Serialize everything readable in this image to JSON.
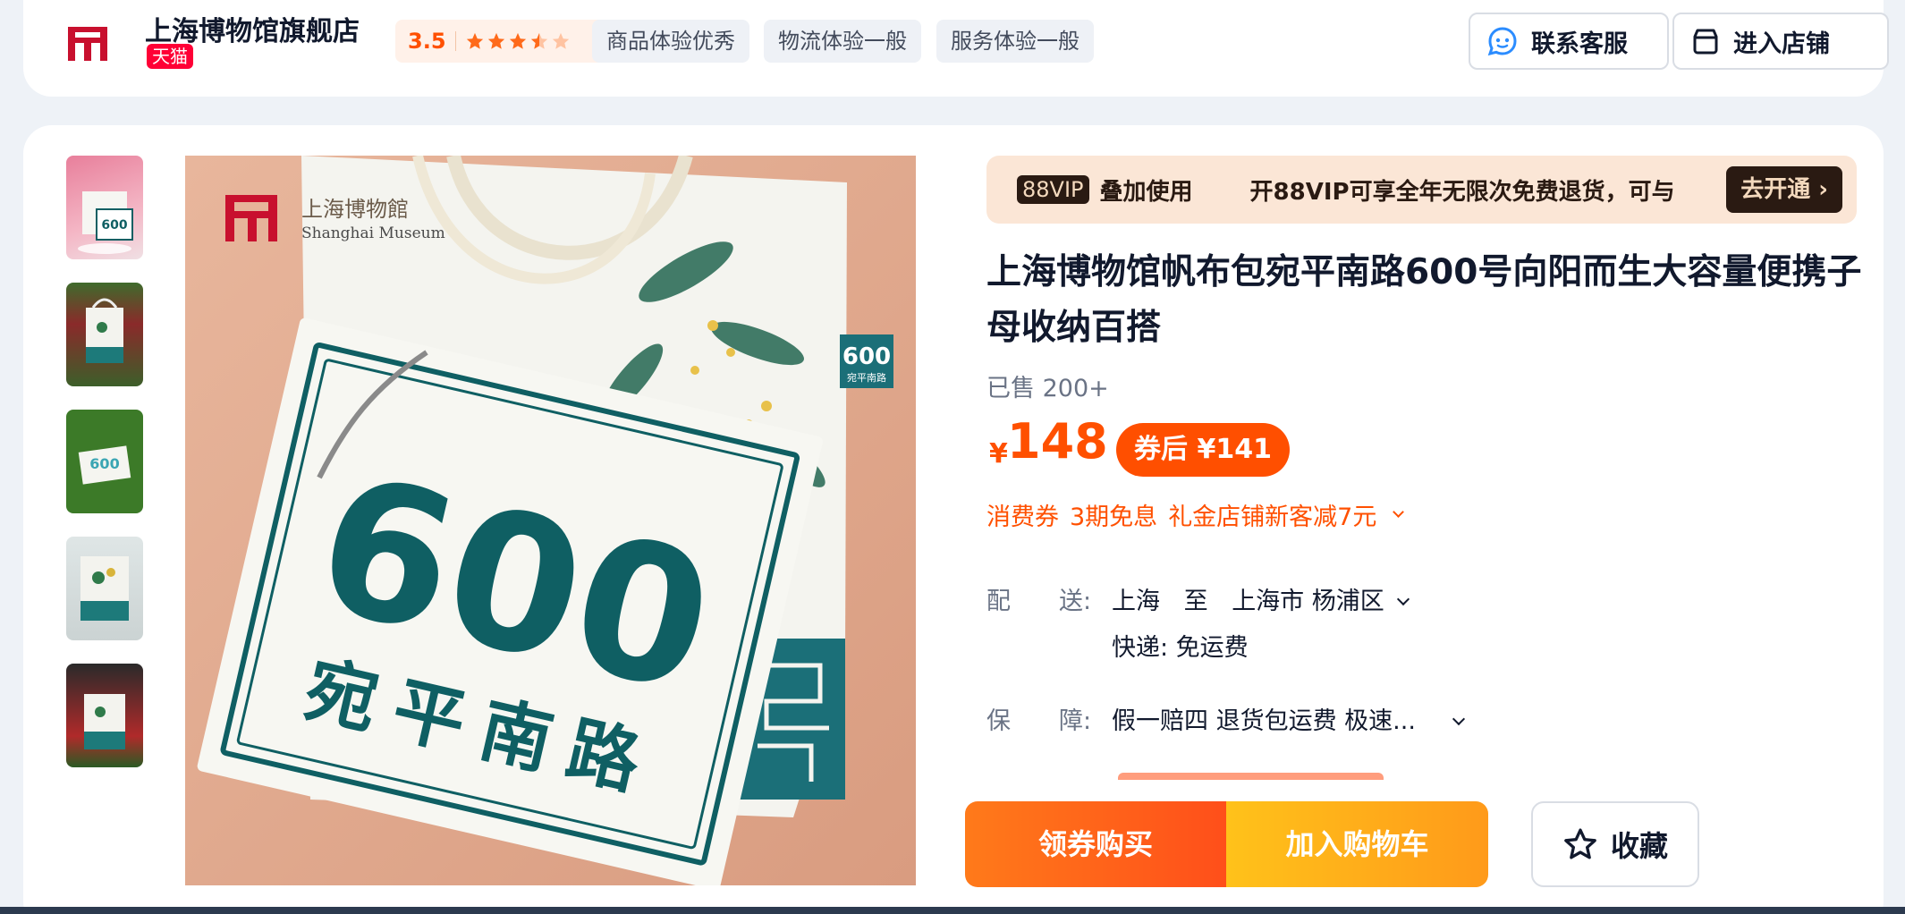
{
  "shop": {
    "name": "上海博物馆旗舰店",
    "badge": "天猫",
    "rating": "3.5",
    "tags": [
      "商品体验优秀",
      "物流体验一般",
      "服务体验一般"
    ],
    "contact_label": "联系客服",
    "enter_label": "进入店铺"
  },
  "gallery": {
    "main_image": {
      "logo_cn": "上海博物館",
      "logo_en": "Shanghai Museum",
      "big_number": "600",
      "street_text": "宛平南路",
      "tag_number": "600",
      "tag_sub": "宛平南路"
    }
  },
  "vip": {
    "badge": "88VIP",
    "use_label": "叠加使用",
    "desc": "开88VIP可享全年无限次免费退货，可与",
    "button": "去开通 ›"
  },
  "product": {
    "title": "上海博物馆帆布包宛平南路600号向阳而生大容量便携子母收纳百搭",
    "sold": "已售 200+",
    "currency": "¥",
    "price": "148",
    "coupon_price": "券后 ¥141",
    "promos": [
      "消费券",
      "3期免息",
      "礼金店铺新客减7元"
    ]
  },
  "delivery": {
    "label": "配　　送:",
    "from": "上海",
    "to_word": "至",
    "to": "上海市 杨浦区",
    "shipping": "快递: 免运费"
  },
  "guarantee": {
    "label": "保　　障:",
    "value": "假一赔四 退货包运费 极速..."
  },
  "actions": {
    "buy": "领券购买",
    "cart": "加入购物车",
    "favorite": "收藏"
  },
  "colors": {
    "accent": "#ff5000",
    "tmall_red": "#ff0036",
    "teal": "#0f5f63"
  },
  "icons": [
    "shanghai-museum-logo-icon",
    "star-icon",
    "customer-service-icon",
    "store-icon",
    "chevron-down-icon",
    "star-outline-icon"
  ]
}
